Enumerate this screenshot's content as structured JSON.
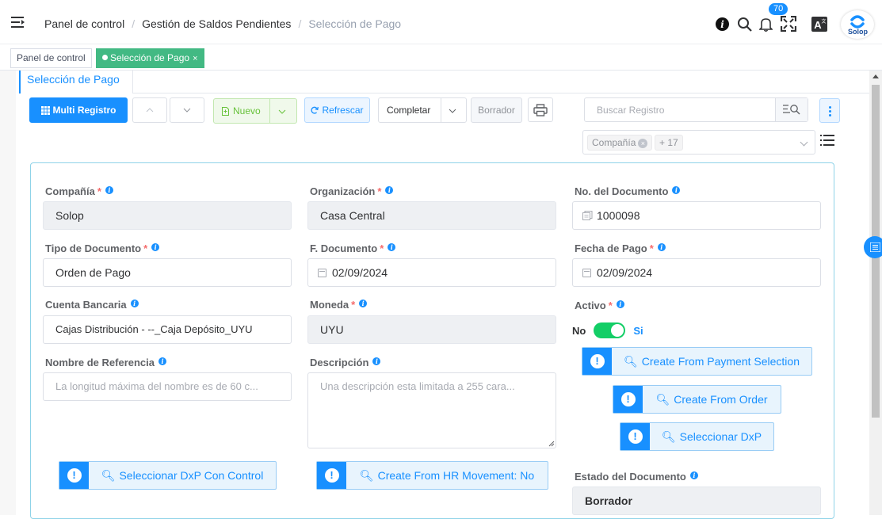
{
  "breadcrumb": [
    "Panel de control",
    "Gestión de Saldos Pendientes",
    "Selección de Pago"
  ],
  "notifications_count": "70",
  "avatar_text": "Solop",
  "tabs": [
    {
      "label": "Panel de control"
    },
    {
      "label": "Selección de Pago",
      "close": "×"
    }
  ],
  "window_tab": "Selección de Pago",
  "toolbar": {
    "multi_registro": "Multi Registro",
    "nuevo": "Nuevo",
    "refrescar": "Refrescar",
    "completar": "Completar",
    "borrador": "Borrador"
  },
  "search": {
    "placeholder": "Buscar Registro"
  },
  "filter": {
    "chip": "Compañía",
    "more": "+ 17"
  },
  "fields": {
    "compania": {
      "label": "Compañía",
      "value": "Solop"
    },
    "organizacion": {
      "label": "Organización",
      "value": "Casa Central"
    },
    "no_documento": {
      "label": "No. del Documento",
      "value": "1000098"
    },
    "tipo_documento": {
      "label": "Tipo de Documento",
      "value": "Orden de Pago"
    },
    "f_documento": {
      "label": "F. Documento",
      "value": "02/09/2024"
    },
    "fecha_pago": {
      "label": "Fecha de Pago",
      "value": "02/09/2024"
    },
    "cuenta_bancaria": {
      "label": "Cuenta Bancaria",
      "value": "Cajas Distribución - --_Caja Depósito_UYU"
    },
    "moneda": {
      "label": "Moneda",
      "value": "UYU"
    },
    "activo": {
      "label": "Activo",
      "off": "No",
      "on": "Si"
    },
    "nombre_referencia": {
      "label": "Nombre de Referencia",
      "placeholder": "La longitud máxima del nombre es de 60 c..."
    },
    "descripcion": {
      "label": "Descripción",
      "placeholder": "Una descripción esta limitada a 255 cara..."
    },
    "estado_documento": {
      "label": "Estado del Documento",
      "value": "Borrador"
    }
  },
  "process_buttons": {
    "create_from_payment_selection": "Create From Payment Selection",
    "create_from_order": "Create From Order",
    "seleccionar_dxp": "Seleccionar DxP",
    "seleccionar_dxp_control": "Seleccionar DxP Con Control",
    "create_from_hr": "Create From HR Movement: No"
  },
  "colors": {
    "primary": "#1890ff",
    "success": "#42b983",
    "switch_on": "#13ce66",
    "required": "#f56c6c"
  }
}
